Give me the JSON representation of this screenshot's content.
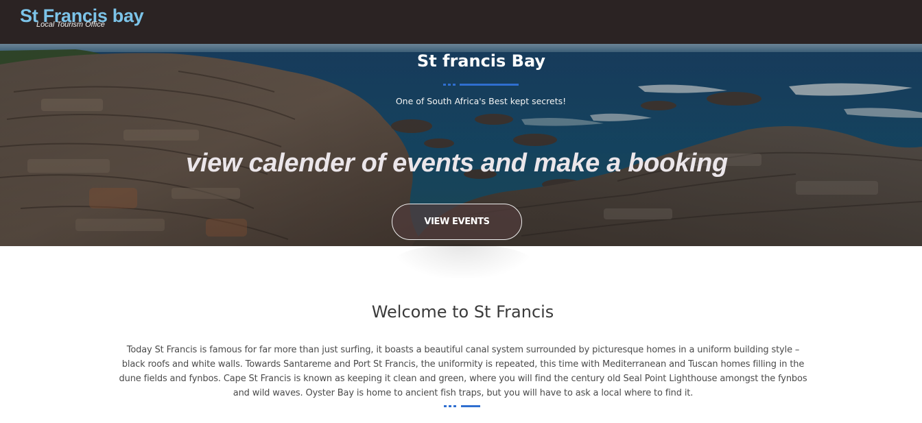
{
  "header": {
    "brand_title": "St Francis bay",
    "brand_subtitle": "Local Tourism Office"
  },
  "hero": {
    "title": "St francis Bay",
    "tagline": "One of South Africa's Best kept secrets!",
    "call_to_action": "view calender of events and make a booking",
    "button_label": "VIEW EVENTS",
    "image_description_icon": "coastal-rocks-photo"
  },
  "welcome": {
    "title": "Welcome to St Francis",
    "body": "Today St Francis is famous for far more than just surfing, it boasts a beautiful canal system surrounded by picturesque homes in a uniform building style – black roofs and white walls. Towards Santareme and Port St Francis, the uniformity is repeated, this time with Mediterranean and Tuscan homes filling in the dune fields and fynbos.  Cape St Francis is known as keeping it clean and green, where you will find the century old Seal Point Lighthouse amongst the fynbos and wild waves.  Oyster Bay is home to ancient fish traps, but you will have to ask a local where to find it."
  },
  "colors": {
    "topbar": "#2b2323",
    "brand": "#7cc3e8",
    "accent_blue": "#2f6fd0",
    "text": "#4a4a4a"
  }
}
